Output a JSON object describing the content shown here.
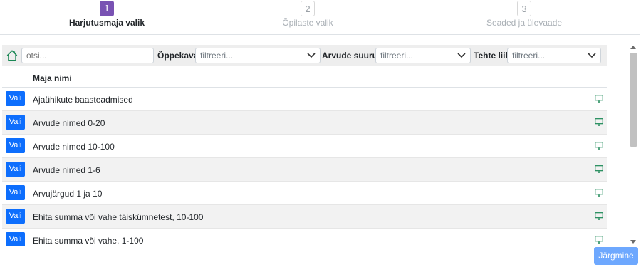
{
  "stepper": {
    "steps": [
      {
        "number": "1",
        "label": "Harjutusmaja valik",
        "state": "active"
      },
      {
        "number": "2",
        "label": "Õpilaste valik",
        "state": "inactive"
      },
      {
        "number": "3",
        "label": "Seaded ja ülevaade",
        "state": "inactive"
      }
    ]
  },
  "filters": {
    "home_icon": "house-icon",
    "search_placeholder": "otsi...",
    "curriculum_label": "Õppekava",
    "curriculum_placeholder": "filtreeri...",
    "number_size_label": "Arvude suurus",
    "number_size_placeholder": "filtreeri...",
    "operation_label": "Tehte liik",
    "operation_placeholder": "filtreeri..."
  },
  "table": {
    "header": "Maja nimi",
    "select_label": "Vali",
    "rows": [
      {
        "name": "Ajaühikute baasteadmised"
      },
      {
        "name": "Arvude nimed 0-20"
      },
      {
        "name": "Arvude nimed 10-100"
      },
      {
        "name": "Arvude nimed 1-6"
      },
      {
        "name": "Arvujärgud 1 ja 10"
      },
      {
        "name": "Ehita summa või vahe täiskümnetest, 10-100"
      },
      {
        "name": "Ehita summa või vahe, 1-100"
      }
    ],
    "row_icon": "monitor-icon"
  },
  "footer": {
    "next_label": "Järgmine"
  },
  "colors": {
    "accent_step": "#7952b3",
    "primary": "#0d6efd",
    "next_disabled": "#6ea8fe",
    "icon_green": "#198754"
  }
}
